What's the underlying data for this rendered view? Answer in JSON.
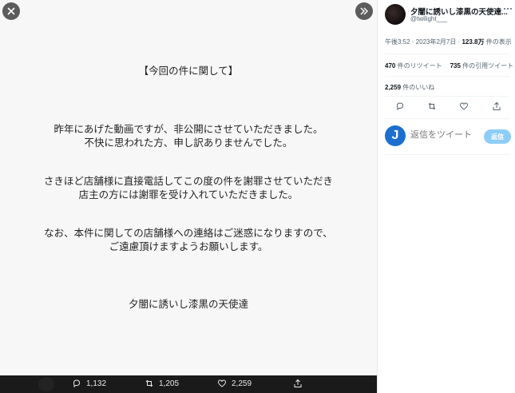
{
  "viewer": {
    "notice": {
      "title": "【今回の件に関して】",
      "para1": [
        "昨年にあげた動画ですが、非公開にさせていただきました。",
        "不快に思われた方、申し訳ありませんでした。"
      ],
      "para2": [
        "さきほど店舗様に直接電話してこの度の件を謝罪させていただき",
        "店主の方には謝罪を受け入れていただきました。"
      ],
      "para3": [
        "なお、本件に関しての店舗様への連絡はご迷惑になりますので、",
        "ご遠慮頂けますようお願いします。"
      ],
      "signature": "夕闇に誘いし漆黒の天使達"
    },
    "bar": {
      "reply_count": "1,132",
      "retweet_count": "1,205",
      "like_count": "2,259"
    }
  },
  "panel": {
    "author_name": "夕闇に誘いし漆黒の天使達...",
    "author_handle": "@twilight___",
    "time": "午後3:52 · 2023年2月7日 · ",
    "views_count": "123.8万",
    "views_label": " 件の表示",
    "retweets_count": "470",
    "retweets_label": " 件のリツイート",
    "quotes_count": "735",
    "quotes_label": " 件の引用ツイート",
    "likes_count": "2,259",
    "likes_label": " 件のいいね",
    "reply_avatar_letter": "J",
    "reply_placeholder": "返信をツイート",
    "reply_button": "返信"
  },
  "colors": {
    "accent": "#1d9bf0",
    "reply_button_disabled": "#8ecdf8",
    "bar_background": "#1a1a1a"
  },
  "icons": [
    "close-icon",
    "expand-icon",
    "more-icon",
    "reply-icon",
    "retweet-icon",
    "like-icon",
    "share-icon"
  ]
}
